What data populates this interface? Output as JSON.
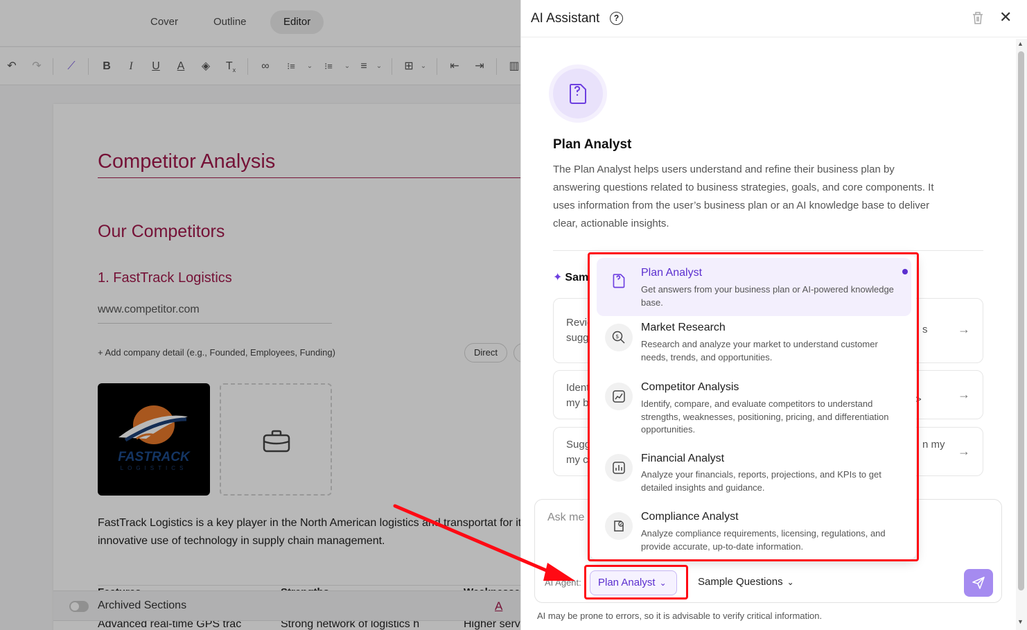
{
  "editor": {
    "tabs": [
      "Cover",
      "Outline",
      "Editor"
    ],
    "doc_title": "Competitor Analysis",
    "section_title": "Our Competitors",
    "competitor_title": "1. FastTrack Logistics",
    "competitor_url": "www.competitor.com",
    "add_detail": "+ Add company detail (e.g., Founded, Employees, Funding)",
    "chip_direct": "Direct",
    "logo_text": "FASTRACK",
    "logo_sub": "LOGISTICS",
    "paragraph": "FastTrack Logistics is a key player in the North American logistics and transportat for its innovative use of technology in supply chain management.",
    "table_headers": [
      "Features",
      "Strengths",
      "Weaknesses"
    ],
    "table_row": [
      "Advanced real-time GPS trac",
      "Strong network of logistics h",
      "Higher serv"
    ],
    "archived_label": "Archived Sections"
  },
  "panel": {
    "title": "AI Assistant",
    "agent_name": "Plan Analyst",
    "agent_description": "The Plan Analyst helps users understand and refine their business plan by answering questions related to business strategies, goals, and core components. It uses information from the user’s business plan or an AI knowledge base to deliver clear, actionable insights.",
    "sample_heading": "Sam",
    "questions": [
      {
        "line1": "Revie",
        "line2": "sugg",
        "tail": "s"
      },
      {
        "line1": "Ident",
        "line2": "my b",
        "tail": ">"
      },
      {
        "line1": "Sugg",
        "line2": "my c",
        "tail": "n my"
      }
    ],
    "chat_placeholder": "Ask me a",
    "agent_label": "AI Agent:",
    "agent_selected": "Plan Analyst",
    "sample_questions_label": "Sample Questions",
    "disclaimer": "AI may be prone to errors, so it is advisable to verify critical information."
  },
  "dropdown": {
    "items": [
      {
        "title": "Plan Analyst",
        "description": "Get answers from your business plan or AI-powered knowledge base."
      },
      {
        "title": "Market Research",
        "description": "Research and analyze your market to understand customer needs, trends, and opportunities."
      },
      {
        "title": "Competitor Analysis",
        "description": "Identify, compare, and evaluate competitors to understand strengths, weaknesses, positioning, pricing, and differentiation opportunities."
      },
      {
        "title": "Financial Analyst",
        "description": "Analyze your financials, reports, projections, and KPIs to get detailed insights and guidance."
      },
      {
        "title": "Compliance Analyst",
        "description": "Analyze compliance requirements, licensing, regulations, and provide accurate, up-to-date information."
      }
    ]
  },
  "colors": {
    "accent_purple": "#5b2fcf",
    "heading_crimson": "#a31a4d",
    "annotation_red": "#ff0a14"
  },
  "icons": [
    "undo-icon",
    "redo-icon",
    "magic-wand-icon",
    "bold-icon",
    "italic-icon",
    "underline-icon",
    "font-color-icon",
    "fill-color-icon",
    "clear-format-icon",
    "link-icon",
    "numbered-list-icon",
    "bullet-list-icon",
    "align-icon",
    "table-icon",
    "outdent-icon",
    "indent-icon",
    "layout-icon",
    "help-icon",
    "trash-icon",
    "close-icon",
    "send-icon"
  ]
}
